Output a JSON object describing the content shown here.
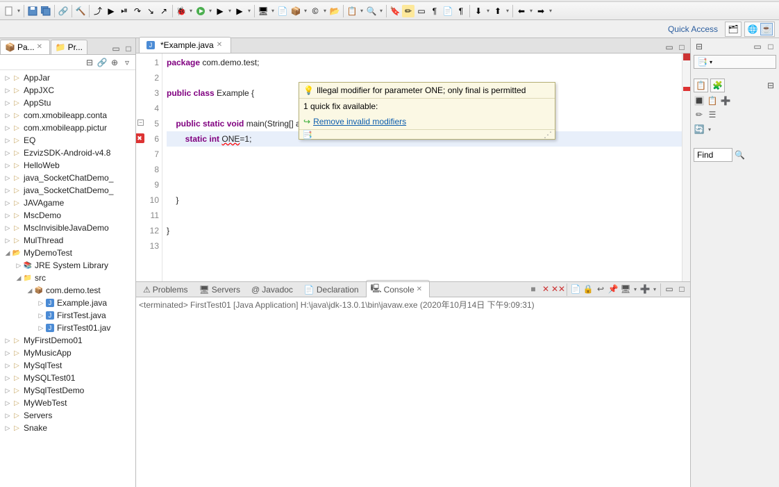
{
  "quickAccess": "Quick Access",
  "leftTabs": {
    "pa": "Pa...",
    "pr": "Pr..."
  },
  "projects": [
    {
      "lbl": "AppJar",
      "lvl": 0,
      "ic": "proj-closed",
      "tw": "▷"
    },
    {
      "lbl": "AppJXC",
      "lvl": 0,
      "ic": "proj-closed",
      "tw": "▷"
    },
    {
      "lbl": "AppStu",
      "lvl": 0,
      "ic": "proj-closed",
      "tw": "▷"
    },
    {
      "lbl": "com.xmobileapp.conta",
      "lvl": 0,
      "ic": "proj-closed",
      "tw": "▷"
    },
    {
      "lbl": "com.xmobileapp.pictur",
      "lvl": 0,
      "ic": "proj-closed",
      "tw": "▷"
    },
    {
      "lbl": "EQ",
      "lvl": 0,
      "ic": "proj-closed",
      "tw": "▷"
    },
    {
      "lbl": "EzvizSDK-Android-v4.8",
      "lvl": 0,
      "ic": "proj-closed",
      "tw": "▷"
    },
    {
      "lbl": "HelloWeb",
      "lvl": 0,
      "ic": "proj-closed",
      "tw": "▷"
    },
    {
      "lbl": "java_SocketChatDemo_",
      "lvl": 0,
      "ic": "proj-closed",
      "tw": "▷"
    },
    {
      "lbl": "java_SocketChatDemo_",
      "lvl": 0,
      "ic": "proj-closed",
      "tw": "▷"
    },
    {
      "lbl": "JAVAgame",
      "lvl": 0,
      "ic": "proj-closed",
      "tw": "▷"
    },
    {
      "lbl": "MscDemo",
      "lvl": 0,
      "ic": "proj-closed",
      "tw": "▷"
    },
    {
      "lbl": "MscInvisibleJavaDemo",
      "lvl": 0,
      "ic": "proj-closed",
      "tw": "▷"
    },
    {
      "lbl": "MulThread",
      "lvl": 0,
      "ic": "proj-closed",
      "tw": "▷"
    },
    {
      "lbl": "MyDemoTest",
      "lvl": 0,
      "ic": "proj-open",
      "tw": "◢"
    },
    {
      "lbl": "JRE System Library",
      "lvl": 1,
      "ic": "lib-ic",
      "tw": "▷"
    },
    {
      "lbl": "src",
      "lvl": 1,
      "ic": "fold-ic",
      "tw": "◢"
    },
    {
      "lbl": "com.demo.test",
      "lvl": 2,
      "ic": "pkg-ic",
      "tw": "◢"
    },
    {
      "lbl": "Example.java",
      "lvl": 3,
      "ic": "java-ic",
      "tw": "▷"
    },
    {
      "lbl": "FirstTest.java",
      "lvl": 3,
      "ic": "java-ic",
      "tw": "▷"
    },
    {
      "lbl": "FirstTest01.jav",
      "lvl": 3,
      "ic": "java-ic",
      "tw": "▷"
    },
    {
      "lbl": "MyFirstDemo01",
      "lvl": 0,
      "ic": "proj-closed",
      "tw": "▷"
    },
    {
      "lbl": "MyMusicApp",
      "lvl": 0,
      "ic": "proj-closed",
      "tw": "▷"
    },
    {
      "lbl": "MySqlTest",
      "lvl": 0,
      "ic": "proj-closed",
      "tw": "▷"
    },
    {
      "lbl": "MySQLTest01",
      "lvl": 0,
      "ic": "proj-closed",
      "tw": "▷"
    },
    {
      "lbl": "MySqlTestDemo",
      "lvl": 0,
      "ic": "proj-closed",
      "tw": "▷"
    },
    {
      "lbl": "MyWebTest",
      "lvl": 0,
      "ic": "proj-closed",
      "tw": "▷"
    },
    {
      "lbl": "Servers",
      "lvl": 0,
      "ic": "proj-closed",
      "tw": "▷"
    },
    {
      "lbl": "Snake",
      "lvl": 0,
      "ic": "proj-closed",
      "tw": "▷"
    }
  ],
  "editor": {
    "tab": "*Example.java",
    "lines": [
      {
        "n": "1",
        "html": "<span class='kw'>package</span> com.demo.test;"
      },
      {
        "n": "2",
        "html": ""
      },
      {
        "n": "3",
        "html": "<span class='kw'>public class</span> Example {"
      },
      {
        "n": "4",
        "html": ""
      },
      {
        "n": "5",
        "html": "    <span class='kw'>public static void</span> main(String[] args) {",
        "fold": true
      },
      {
        "n": "6",
        "html": "        <span class='kw'>static</span> <span class='kw'>int</span> <span class='err-underline'>ONE</span>=1;",
        "hl": true,
        "err": true
      },
      {
        "n": "7",
        "html": ""
      },
      {
        "n": "8",
        "html": ""
      },
      {
        "n": "9",
        "html": ""
      },
      {
        "n": "10",
        "html": "    }"
      },
      {
        "n": "11",
        "html": ""
      },
      {
        "n": "12",
        "html": "}"
      },
      {
        "n": "13",
        "html": ""
      }
    ]
  },
  "tooltip": {
    "error": "Illegal modifier for parameter ONE; only final is permitted",
    "avail": "1 quick fix available:",
    "fix": "Remove invalid modifiers"
  },
  "bottomTabs": {
    "problems": "Problems",
    "servers": "Servers",
    "javadoc": "Javadoc",
    "declaration": "Declaration",
    "console": "Console"
  },
  "console": {
    "line": "<terminated> FirstTest01 [Java Application] H:\\java\\jdk-13.0.1\\bin\\javaw.exe (2020年10月14日 下午9:09:31)"
  },
  "find": "Find"
}
